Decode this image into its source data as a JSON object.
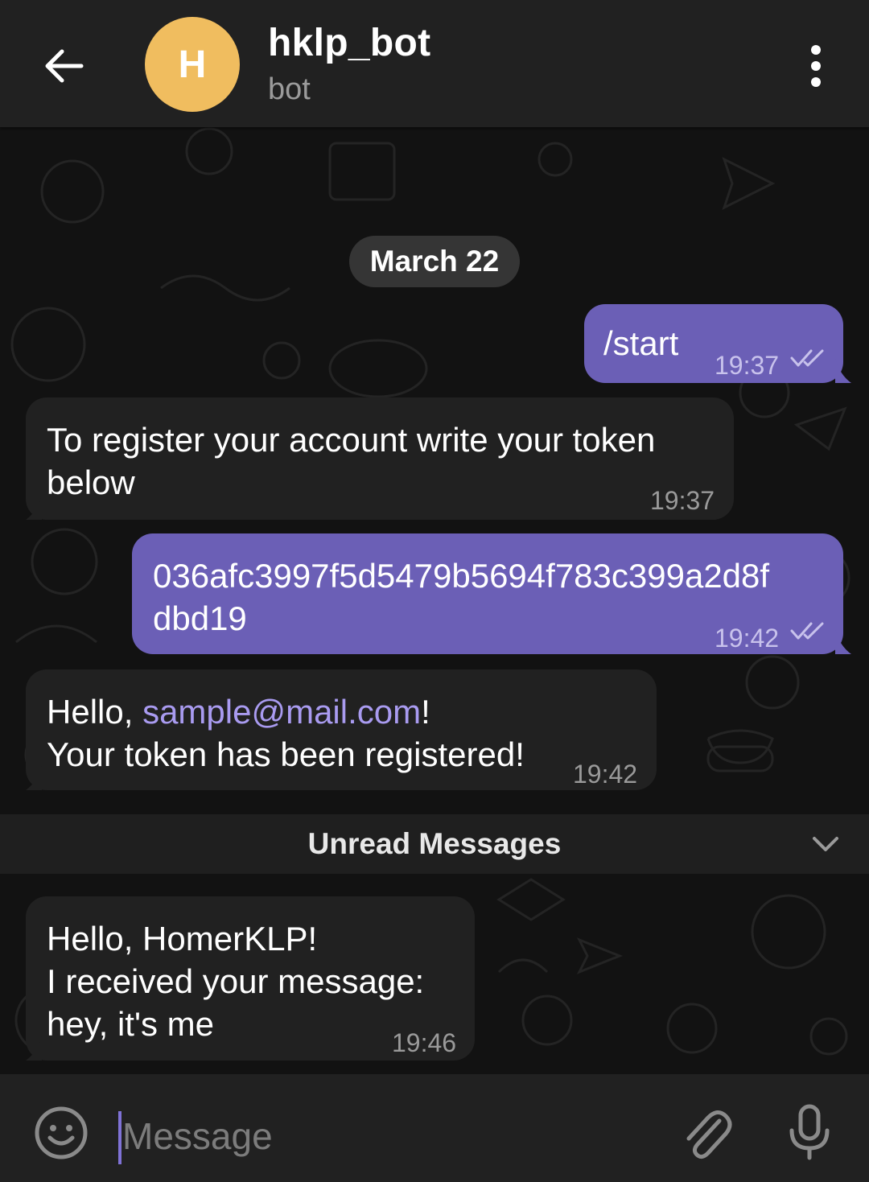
{
  "header": {
    "title": "hklp_bot",
    "status": "bot",
    "avatar_letter": "H",
    "avatar_color": "#f0bd5f"
  },
  "chat": {
    "date": "March 22",
    "messages": [
      {
        "direction": "outgoing",
        "text": "/start",
        "time": "19:37",
        "status": "read"
      },
      {
        "direction": "incoming",
        "lines": [
          "To register your account write your token",
          "below"
        ],
        "time": "19:37"
      },
      {
        "direction": "outgoing",
        "lines": [
          "036afc3997f5d5479b5694f783c399a2d8f",
          "dbd19"
        ],
        "time": "19:42",
        "status": "read"
      },
      {
        "direction": "incoming",
        "prefix": "Hello, ",
        "link": "sample@mail.com",
        "suffix": "!",
        "line2": "Your token has been registered!",
        "time": "19:42"
      },
      {
        "direction": "incoming",
        "lines": [
          "Hello, HomerKLP!",
          "I received your message:",
          "hey, it's me"
        ],
        "time": "19:46"
      }
    ],
    "unread_label": "Unread Messages"
  },
  "input": {
    "placeholder": "Message"
  },
  "icons": {
    "back": "arrow-left-icon",
    "menu": "more-vertical-icon",
    "emoji": "smile-icon",
    "attach": "paperclip-icon",
    "mic": "microphone-icon",
    "ticks": "double-check-icon",
    "chevron": "chevron-down-icon"
  },
  "colors": {
    "outgoing_bubble": "#6b5fb6",
    "incoming_bubble": "#212121",
    "link": "#a99bf0",
    "accent": "#7f72d6"
  }
}
